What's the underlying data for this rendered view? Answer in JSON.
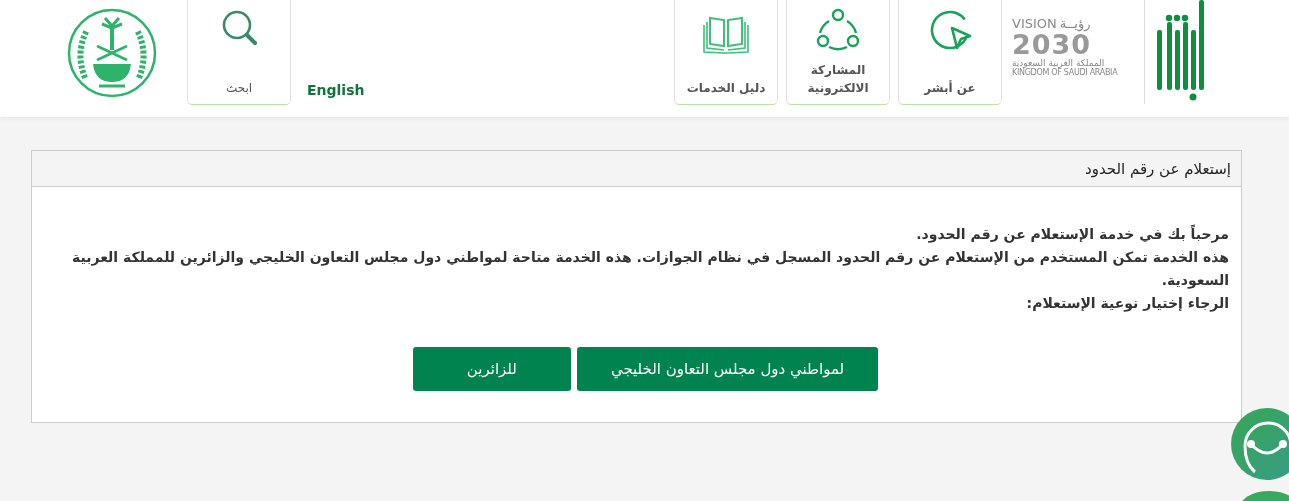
{
  "header": {
    "vision_logo": {
      "arabic": "رؤيــة",
      "latin": "VISION",
      "year": "2030",
      "country_ar": "المملكة العربية السعودية",
      "country_en": "KINGDOM OF SAUDI ARABIA"
    },
    "nav": [
      {
        "kind": "cursor",
        "label": "عن أبشر"
      },
      {
        "kind": "share",
        "label": "المشاركة الالكترونية"
      },
      {
        "kind": "book",
        "label": "دليل الخدمات"
      }
    ],
    "language": "English",
    "search": {
      "label": "ابحث"
    }
  },
  "panel": {
    "title": "إستعلام عن رقم الحدود",
    "paragraphs": [
      "مرحباً بك في خدمة الإستعلام عن رقم الحدود.",
      "هذه الخدمة تمكن المستخدم من الإستعلام عن رقم الحدود المسجل في نظام الجوازات. هذه الخدمة متاحة لمواطني دول مجلس التعاون الخليجي والزائرين للمملكة العربية السعودية.",
      "الرجاء إختيار نوعية الإستعلام:"
    ],
    "buttons": [
      "لمواطني دول مجلس التعاون الخليجي",
      "للزائرين"
    ]
  }
}
